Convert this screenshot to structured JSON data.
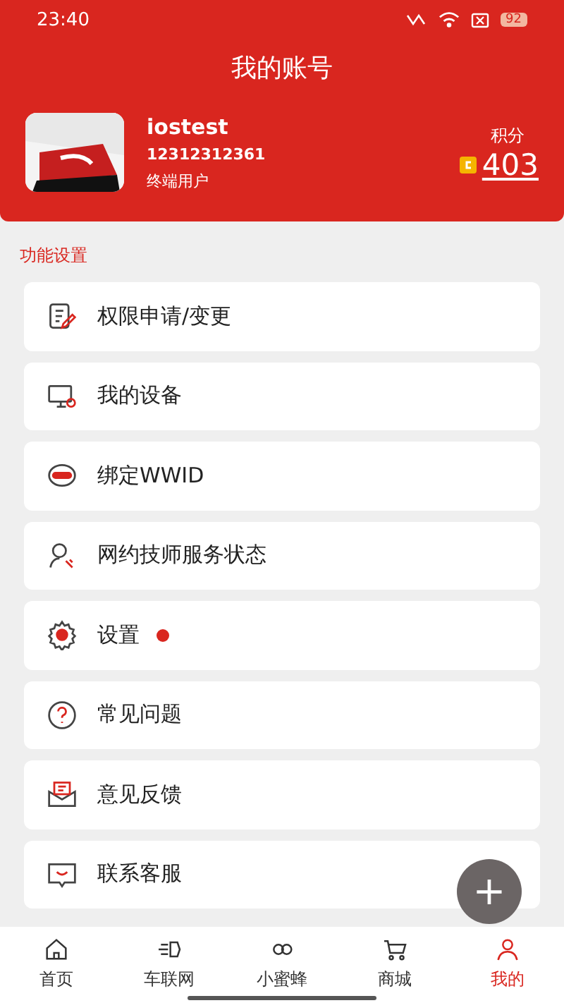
{
  "status_bar": {
    "time": "23:40",
    "battery": "92"
  },
  "header": {
    "title": "我的账号"
  },
  "profile": {
    "name": "iostest",
    "phone": "12312312361",
    "role": "终端用户",
    "points_label": "积分",
    "points": "403"
  },
  "section": {
    "title": "功能设置"
  },
  "menu": [
    {
      "label": "权限申请/变更",
      "dot": false
    },
    {
      "label": "我的设备",
      "dot": false
    },
    {
      "label": "绑定WWID",
      "dot": false
    },
    {
      "label": "网约技师服务状态",
      "dot": false
    },
    {
      "label": "设置",
      "dot": true
    },
    {
      "label": "常见问题",
      "dot": false
    },
    {
      "label": "意见反馈",
      "dot": false
    },
    {
      "label": "联系客服",
      "dot": false
    }
  ],
  "fab": {
    "symbol": "+"
  },
  "tab_bar": [
    {
      "label": "首页",
      "selected": false
    },
    {
      "label": "车联网",
      "selected": false
    },
    {
      "label": "小蜜蜂",
      "selected": false
    },
    {
      "label": "商城",
      "selected": false
    },
    {
      "label": "我的",
      "selected": true
    }
  ]
}
